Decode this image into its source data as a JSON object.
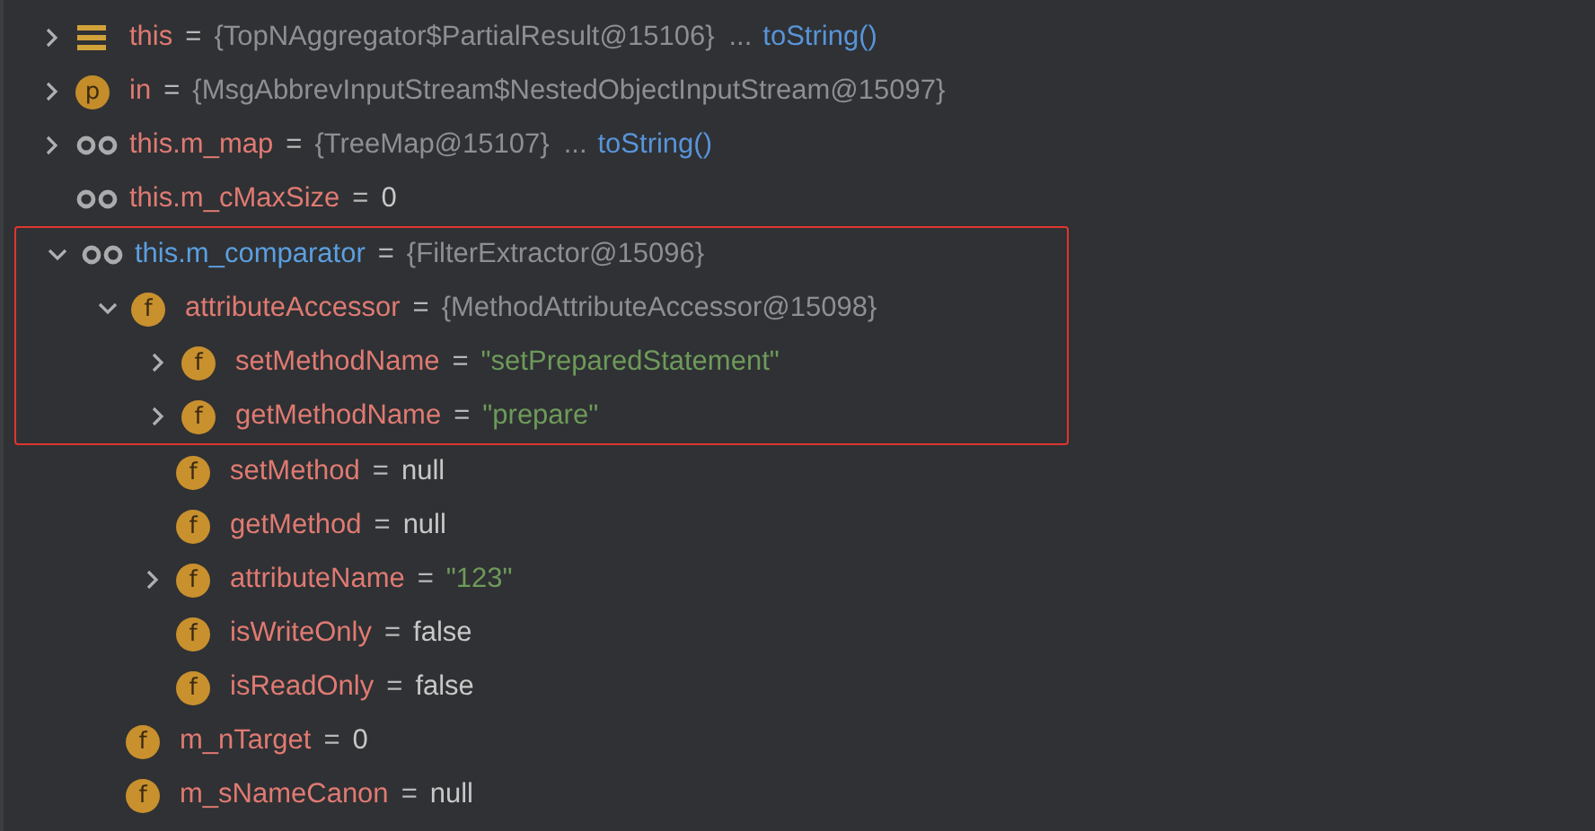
{
  "variables": [
    {
      "kind": "stack",
      "name": "this",
      "eq": "=",
      "value": {
        "kind": "object",
        "text": "{TopNAggregator$PartialResult@15106}"
      },
      "more": "...",
      "link": "toString()",
      "expanded": false,
      "marked": false,
      "framed": false
    },
    {
      "kind": "param",
      "badge": "p",
      "name": "in",
      "eq": "=",
      "value": {
        "kind": "object",
        "text": "{MsgAbbrevInputStream$NestedObjectInputStream@15097}"
      },
      "expanded": false,
      "marked": false,
      "framed": false
    },
    {
      "kind": "watch",
      "name": "this.m_map",
      "eq": "=",
      "value": {
        "kind": "object",
        "text": "{TreeMap@15107}"
      },
      "more": "...",
      "link": "toString()",
      "expanded": false,
      "marked": false,
      "framed": false
    },
    {
      "kind": "watch",
      "name": "this.m_cMaxSize",
      "eq": "=",
      "value": {
        "kind": "primitive",
        "text": "0"
      },
      "marked": false,
      "framed": false
    },
    {
      "kind": "watch",
      "name": "this.m_comparator",
      "eq": "=",
      "value": {
        "kind": "object",
        "text": "{FilterExtractor@15096}"
      },
      "expanded": true,
      "marked": true,
      "framed": true,
      "children": [
        {
          "kind": "field",
          "badge": "f",
          "name": "attributeAccessor",
          "eq": "=",
          "value": {
            "kind": "object",
            "text": "{MethodAttributeAccessor@15098}"
          },
          "expanded": true,
          "marked": false,
          "framed": true,
          "children": [
            {
              "kind": "field",
              "badge": "f",
              "name": "setMethodName",
              "eq": "=",
              "value": {
                "kind": "string",
                "text": "\"setPreparedStatement\""
              },
              "expanded": false,
              "marked": false,
              "framed": true
            },
            {
              "kind": "field",
              "badge": "f",
              "name": "getMethodName",
              "eq": "=",
              "value": {
                "kind": "string",
                "text": "\"prepare\""
              },
              "expanded": false,
              "marked": false,
              "framed": true
            },
            {
              "kind": "field",
              "badge": "f",
              "name": "setMethod",
              "eq": "=",
              "value": {
                "kind": "primitive",
                "text": "null"
              },
              "marked": false,
              "framed": false
            },
            {
              "kind": "field",
              "badge": "f",
              "name": "getMethod",
              "eq": "=",
              "value": {
                "kind": "primitive",
                "text": "null"
              },
              "marked": false,
              "framed": false
            },
            {
              "kind": "field",
              "badge": "f",
              "name": "attributeName",
              "eq": "=",
              "value": {
                "kind": "string",
                "text": "\"123\""
              },
              "expanded": false,
              "marked": false,
              "framed": false
            },
            {
              "kind": "field",
              "badge": "f",
              "name": "isWriteOnly",
              "eq": "=",
              "value": {
                "kind": "primitive",
                "text": "false"
              },
              "marked": false,
              "framed": false
            },
            {
              "kind": "field",
              "badge": "f",
              "name": "isReadOnly",
              "eq": "=",
              "value": {
                "kind": "primitive",
                "text": "false"
              },
              "marked": false,
              "framed": false
            }
          ]
        },
        {
          "kind": "field",
          "badge": "f",
          "name": "m_nTarget",
          "eq": "=",
          "value": {
            "kind": "primitive",
            "text": "0"
          },
          "marked": false,
          "framed": false
        },
        {
          "kind": "field",
          "badge": "f",
          "name": "m_sNameCanon",
          "eq": "=",
          "value": {
            "kind": "primitive",
            "text": "null"
          },
          "marked": false,
          "framed": false
        }
      ]
    }
  ]
}
